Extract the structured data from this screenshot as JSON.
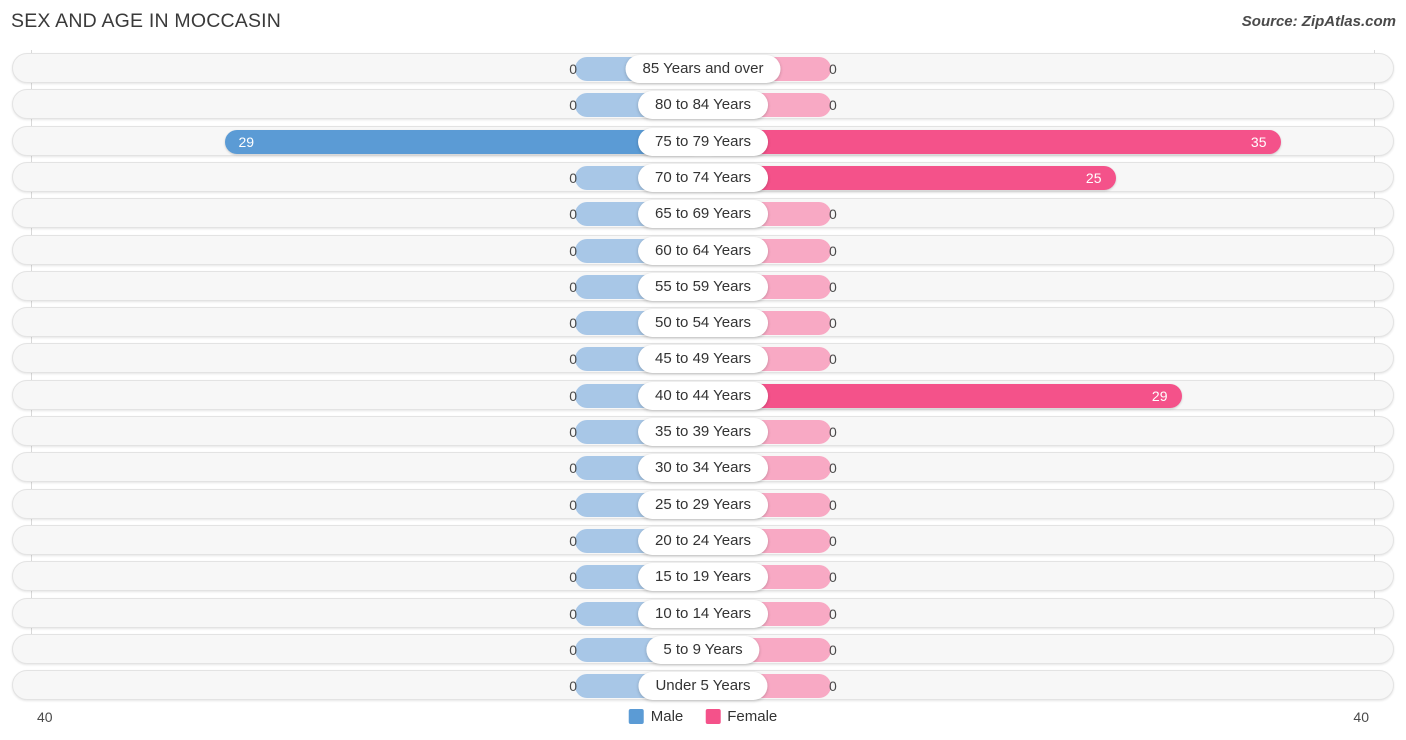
{
  "header": {
    "title": "SEX AND AGE IN MOCCASIN",
    "source": "Source: ZipAtlas.com"
  },
  "axis": {
    "left_end_label": "40",
    "right_end_label": "40",
    "max": 40
  },
  "legend": {
    "male_label": "Male",
    "female_label": "Female",
    "male_color": "#5b9bd5",
    "female_color": "#f4528a",
    "male_zero_color": "#a8c7e7",
    "female_zero_color": "#f8a9c4"
  },
  "chart_data": {
    "type": "bar",
    "title": "SEX AND AGE IN MOCCASIN",
    "subtitle": "Source: ZipAtlas.com",
    "orientation": "horizontal-diverging",
    "xlabel": "",
    "ylabel": "",
    "xlim": [
      40,
      40
    ],
    "grid": true,
    "legend_position": "bottom-center",
    "categories": [
      "85 Years and over",
      "80 to 84 Years",
      "75 to 79 Years",
      "70 to 74 Years",
      "65 to 69 Years",
      "60 to 64 Years",
      "55 to 59 Years",
      "50 to 54 Years",
      "45 to 49 Years",
      "40 to 44 Years",
      "35 to 39 Years",
      "30 to 34 Years",
      "25 to 29 Years",
      "20 to 24 Years",
      "15 to 19 Years",
      "10 to 14 Years",
      "5 to 9 Years",
      "Under 5 Years"
    ],
    "series": [
      {
        "name": "Male",
        "side": "left",
        "values": [
          0,
          0,
          29,
          0,
          0,
          0,
          0,
          0,
          0,
          0,
          0,
          0,
          0,
          0,
          0,
          0,
          0,
          0
        ],
        "labels": [
          "0",
          "0",
          "29",
          "0",
          "0",
          "0",
          "0",
          "0",
          "0",
          "0",
          "0",
          "0",
          "0",
          "0",
          "0",
          "0",
          "0",
          "0"
        ]
      },
      {
        "name": "Female",
        "side": "right",
        "values": [
          0,
          0,
          35,
          25,
          0,
          0,
          0,
          0,
          0,
          29,
          0,
          0,
          0,
          0,
          0,
          0,
          0,
          0
        ],
        "labels": [
          "0",
          "0",
          "35",
          "25",
          "0",
          "0",
          "0",
          "0",
          "0",
          "29",
          "0",
          "0",
          "0",
          "0",
          "0",
          "0",
          "0",
          "0"
        ]
      }
    ]
  }
}
